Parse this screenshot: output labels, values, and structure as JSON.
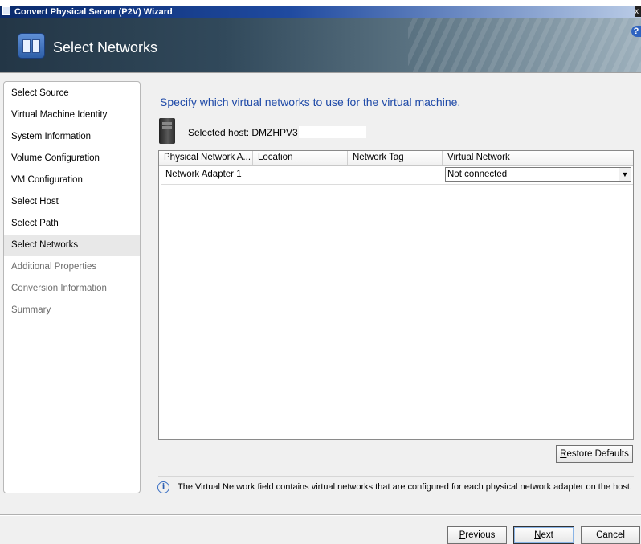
{
  "window": {
    "title": "Convert Physical Server (P2V) Wizard",
    "close_glyph": "x"
  },
  "header": {
    "title": "Select Networks",
    "help_glyph": "?"
  },
  "nav": {
    "items": [
      {
        "label": "Select Source",
        "state": "done"
      },
      {
        "label": "Virtual Machine Identity",
        "state": "done"
      },
      {
        "label": "System Information",
        "state": "done"
      },
      {
        "label": "Volume Configuration",
        "state": "done"
      },
      {
        "label": "VM Configuration",
        "state": "done"
      },
      {
        "label": "Select Host",
        "state": "done"
      },
      {
        "label": "Select Path",
        "state": "done"
      },
      {
        "label": "Select Networks",
        "state": "active"
      },
      {
        "label": "Additional Properties",
        "state": "future"
      },
      {
        "label": "Conversion Information",
        "state": "future"
      },
      {
        "label": "Summary",
        "state": "future"
      }
    ]
  },
  "main": {
    "prompt": "Specify which virtual networks to use for the virtual machine.",
    "host_label": "Selected host: DMZHPV3",
    "grid": {
      "columns": [
        "Physical Network A...",
        "Location",
        "Network Tag",
        "Virtual Network"
      ],
      "rows": [
        {
          "adapter": "Network Adapter 1",
          "location": "",
          "tag": "",
          "virtual_network": "Not connected"
        }
      ]
    },
    "restore_defaults": {
      "pre": "",
      "accel": "R",
      "post": "estore Defaults"
    },
    "info_text": "The Virtual Network field contains virtual networks that are configured for each physical network adapter on the host."
  },
  "footer": {
    "previous": {
      "pre": "",
      "accel": "P",
      "post": "revious"
    },
    "next": {
      "pre": "",
      "accel": "N",
      "post": "ext"
    },
    "cancel": "Cancel"
  },
  "colors": {
    "prompt": "#1f4aa8",
    "titlebar": "#0a2a6b",
    "header": "#31495b"
  }
}
